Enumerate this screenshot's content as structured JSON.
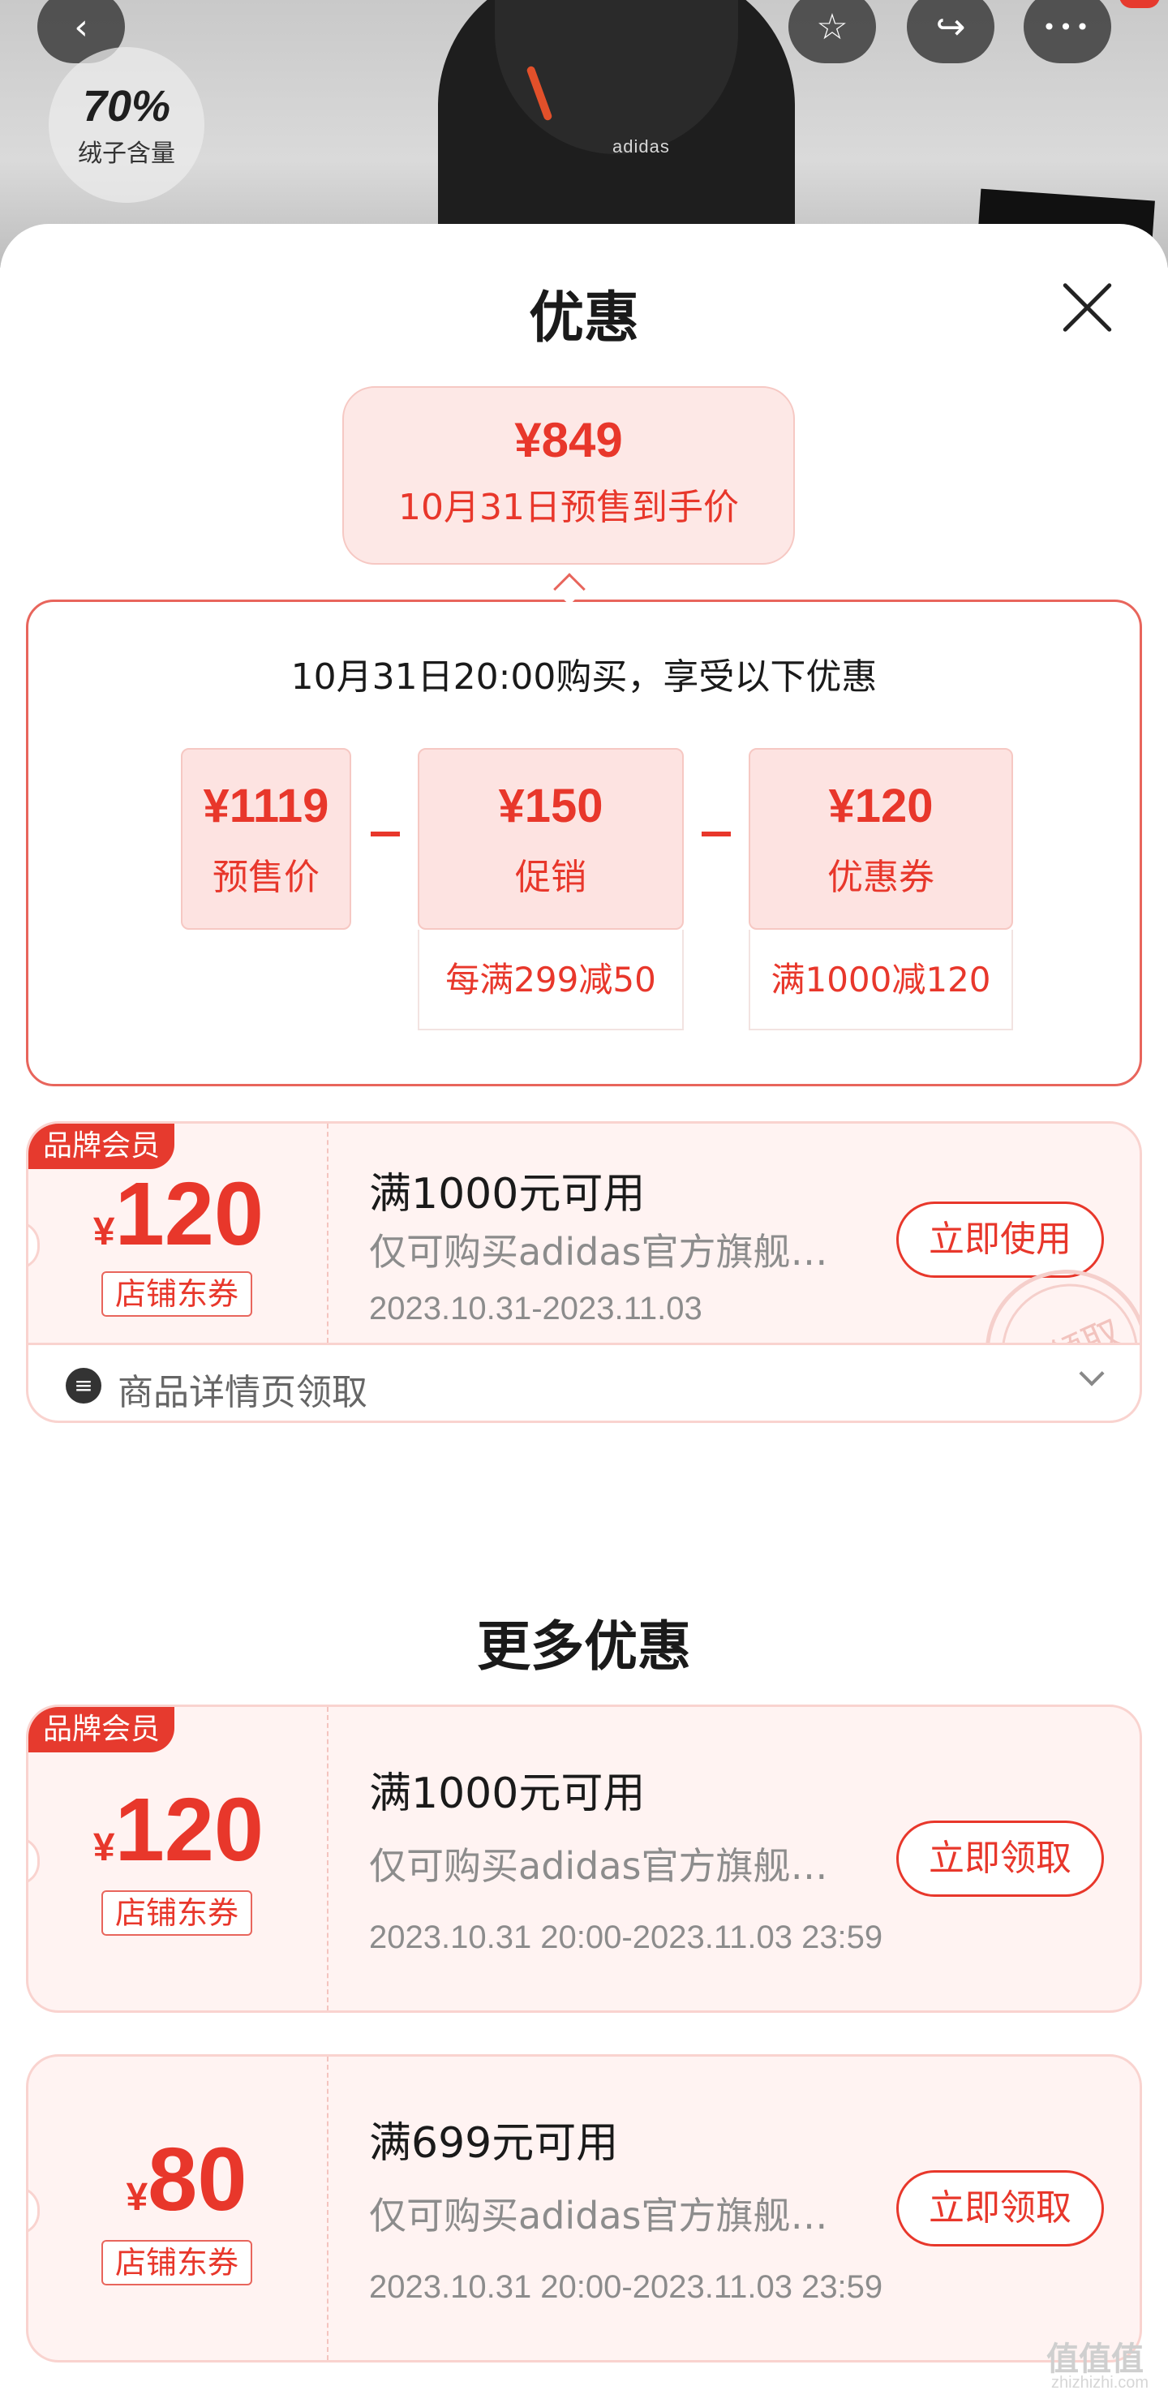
{
  "nav": {
    "back_glyph": "‹",
    "fav_glyph": "☆",
    "share_glyph": "↪",
    "more_glyph": "•••"
  },
  "product": {
    "down_content_pct": "70%",
    "down_content_label": "绒子含量",
    "brand_mark": "adidas"
  },
  "sheet": {
    "title": "优惠",
    "final_price": "¥849",
    "final_label": "10月31日预售到手价"
  },
  "calc": {
    "title": "10月31日20:00购买，享受以下优惠",
    "items": [
      {
        "value": "¥1119",
        "label": "预售价"
      },
      {
        "value": "¥150",
        "label": "促销",
        "sub": "每满299减50"
      },
      {
        "value": "¥120",
        "label": "优惠券",
        "sub": "满1000减120"
      }
    ]
  },
  "coupons": [
    {
      "tag": "品牌会员",
      "symbol": "¥",
      "amount": "120",
      "type": "店铺东券",
      "condition": "满1000元可用",
      "scope": "仅可购买adidas官方旗舰店商品",
      "date": "2023.10.31-2023.11.03",
      "button": "立即使用",
      "stamp": "已领取",
      "footer": "商品详情页领取"
    },
    {
      "tag": "品牌会员",
      "symbol": "¥",
      "amount": "120",
      "type": "店铺东券",
      "condition": "满1000元可用",
      "scope": "仅可购买adidas官方旗舰店商品",
      "date": "2023.10.31 20:00-2023.11.03 23:59",
      "button": "立即领取"
    },
    {
      "symbol": "¥",
      "amount": "80",
      "type": "店铺东券",
      "condition": "满699元可用",
      "scope": "仅可购买adidas官方旗舰店商品",
      "date": "2023.10.31 20:00-2023.11.03 23:59",
      "button": "立即领取"
    }
  ],
  "more_title": "更多优惠",
  "watermark": {
    "main": "值值值",
    "sub": "zhizhizhi.com"
  },
  "colors": {
    "accent": "#e8372b",
    "coupon_bg": "#fff3f2",
    "tag_bg": "#e63a2e"
  }
}
